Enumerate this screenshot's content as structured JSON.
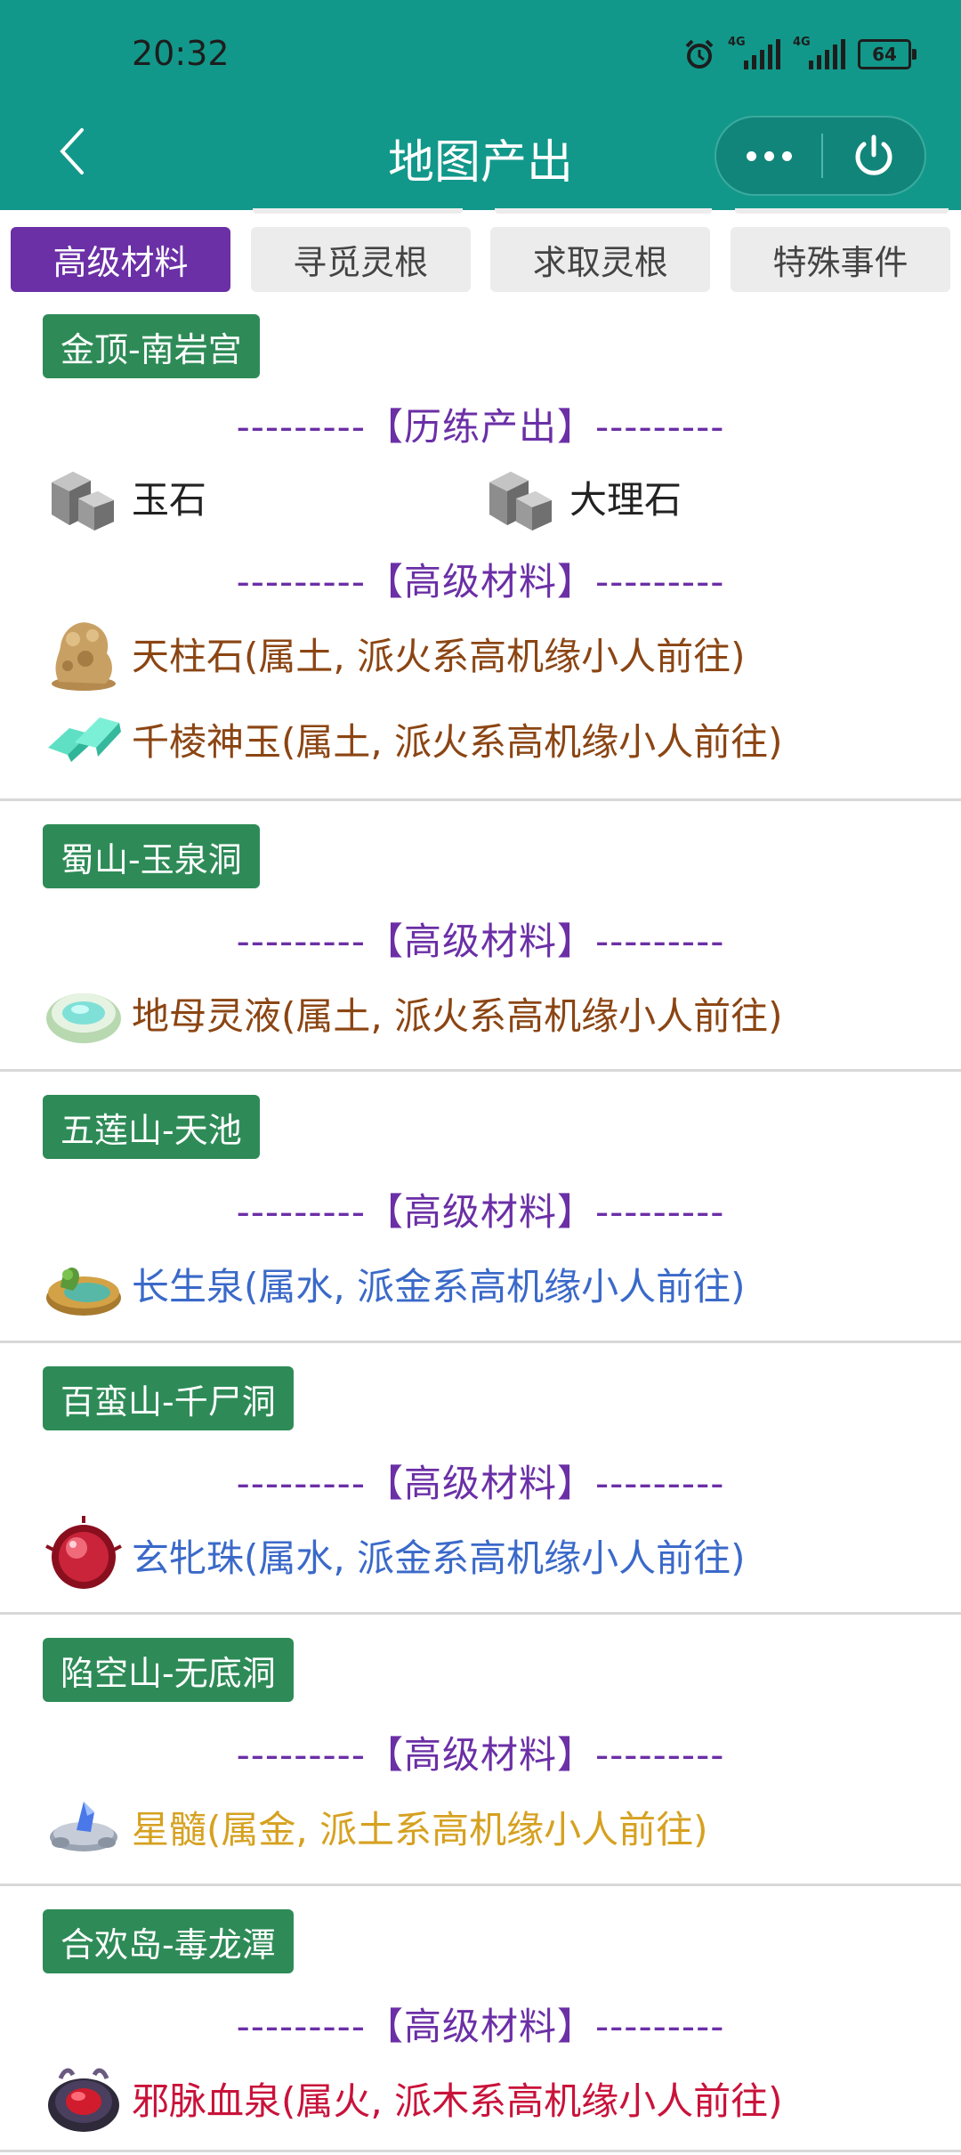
{
  "status_bar": {
    "time": "20:32",
    "network_1": "4G",
    "network_2": "4G",
    "battery": "64"
  },
  "nav": {
    "title": "地图产出",
    "back_icon": "chevron-left-icon",
    "more_icon": "more-dots-icon",
    "power_icon": "power-icon"
  },
  "tabs": [
    {
      "label": "高级材料",
      "active": true
    },
    {
      "label": "寻觅灵根",
      "active": false
    },
    {
      "label": "求取灵根",
      "active": false
    },
    {
      "label": "特殊事件",
      "active": false
    }
  ],
  "colors": {
    "header": "#12988a",
    "tab_active": "#6b2fa6",
    "location_tag": "#2e8b57",
    "earth": "#8b4513",
    "water": "#3a69c9",
    "metal": "#d6a120",
    "fire": "#c9123a"
  },
  "sections": [
    {
      "location": "金顶-南岩宫",
      "training_header": "---------【历练产出】---------",
      "training_items": [
        {
          "name": "玉石",
          "icon": "stone-block-icon"
        },
        {
          "name": "大理石",
          "icon": "stone-block-icon"
        }
      ],
      "material_header": "---------【高级材料】---------",
      "materials": [
        {
          "text": "天柱石(属土, 派火系高机缘小人前往)",
          "icon": "rock-pillar-icon",
          "element": "earth"
        },
        {
          "text": "千棱神玉(属土, 派火系高机缘小人前往)",
          "icon": "jade-crystal-icon",
          "element": "earth"
        }
      ]
    },
    {
      "location": "蜀山-玉泉洞",
      "material_header": "---------【高级材料】---------",
      "materials": [
        {
          "text": "地母灵液(属土, 派火系高机缘小人前往)",
          "icon": "spring-pool-icon",
          "element": "earth"
        }
      ]
    },
    {
      "location": "五莲山-天池",
      "material_header": "---------【高级材料】---------",
      "materials": [
        {
          "text": "长生泉(属水, 派金系高机缘小人前往)",
          "icon": "island-spring-icon",
          "element": "water"
        }
      ]
    },
    {
      "location": "百蛮山-千尸洞",
      "material_header": "---------【高级材料】---------",
      "materials": [
        {
          "text": "玄牝珠(属水, 派金系高机缘小人前往)",
          "icon": "red-orb-icon",
          "element": "water"
        }
      ]
    },
    {
      "location": "陷空山-无底洞",
      "material_header": "---------【高级材料】---------",
      "materials": [
        {
          "text": "星髓(属金, 派土系高机缘小人前往)",
          "icon": "star-marrow-icon",
          "element": "metal"
        }
      ]
    },
    {
      "location": "合欢岛-毒龙潭",
      "material_header": "---------【高级材料】---------",
      "materials": [
        {
          "text": "邪脉血泉(属火, 派木系高机缘小人前往)",
          "icon": "blood-spring-icon",
          "element": "fire"
        }
      ]
    }
  ]
}
